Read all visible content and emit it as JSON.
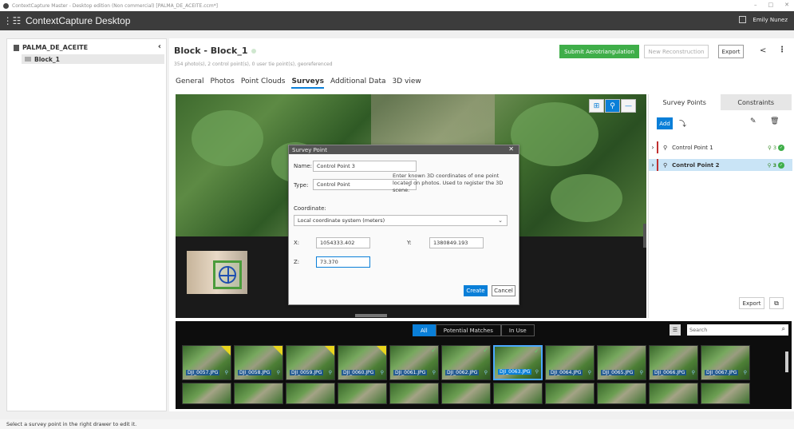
{
  "window": {
    "title": "ContextCapture Master - Desktop edition (Non commercial) [PALMA_DE_ACEITE.ccm*]",
    "controls": [
      "–",
      "□",
      "✕"
    ]
  },
  "appbar": {
    "title": "ContextCapture Desktop",
    "user": "Emily Nunez"
  },
  "sidebar": {
    "project": "PALMA_DE_ACEITE",
    "collapse": "‹",
    "block": "Block_1"
  },
  "main": {
    "title": "Block - Block_1",
    "subtitle": "354 photo(s), 2 control point(s), 0 user tie point(s), georeferenced",
    "tabs": [
      "General",
      "Photos",
      "Point Clouds",
      "Surveys",
      "Additional Data",
      "3D view"
    ],
    "active_tab": "Surveys",
    "buttons": {
      "submit": "Submit Aerotriangulation",
      "reconstruction": "New Reconstruction",
      "export": "Export"
    }
  },
  "dialog": {
    "title": "Survey Point",
    "close": "✕",
    "name_label": "Name:",
    "name_value": "Control Point 3",
    "type_label": "Type:",
    "type_value": "Control Point",
    "info": "Enter known 3D coordinates of one point located on photos. Used to register the 3D scene.",
    "coord_label": "Coordinate:",
    "coord_system": "Local coordinate system (meters)",
    "x_label": "X:",
    "x_value": "1054333.402",
    "y_label": "Y:",
    "y_value": "1380849.193",
    "z_label": "Z:",
    "z_value": "73.370",
    "create": "Create",
    "cancel": "Cancel"
  },
  "drawer": {
    "tabs": [
      "Survey Points",
      "Constraints"
    ],
    "active_tab": "Survey Points",
    "add": "Add",
    "points": [
      {
        "name": "Control Point 1",
        "count": "3",
        "selected": false
      },
      {
        "name": "Control Point 2",
        "count": "3",
        "selected": true
      }
    ],
    "export": "Export"
  },
  "strip": {
    "filters": [
      "All",
      "Potential Matches",
      "In Use"
    ],
    "active_filter": "All",
    "search_placeholder": "Search",
    "photos": [
      {
        "name": "DJI_0057.JPG",
        "badge": "yellow"
      },
      {
        "name": "DJI_0058.JPG",
        "badge": "yellow"
      },
      {
        "name": "DJI_0059.JPG",
        "badge": "yellow"
      },
      {
        "name": "DJI_0060.JPG",
        "badge": "yellow"
      },
      {
        "name": "DJI_0061.JPG",
        "badge": "check"
      },
      {
        "name": "DJI_0062.JPG",
        "badge": "check"
      },
      {
        "name": "DJI_0063.JPG",
        "badge": "check",
        "selected": true
      },
      {
        "name": "DJI_0064.JPG",
        "badge": "none"
      },
      {
        "name": "DJI_0065.JPG",
        "badge": "none"
      },
      {
        "name": "DJI_0066.JPG",
        "badge": "none"
      },
      {
        "name": "DJI_0067.JPG",
        "badge": "none"
      }
    ]
  },
  "status": "Select a survey point in the right drawer to edit it.",
  "colors": {
    "accent": "#0a7fd8",
    "success": "#3fae49",
    "appbar": "#3c3c3c",
    "marker": "#c03030"
  }
}
